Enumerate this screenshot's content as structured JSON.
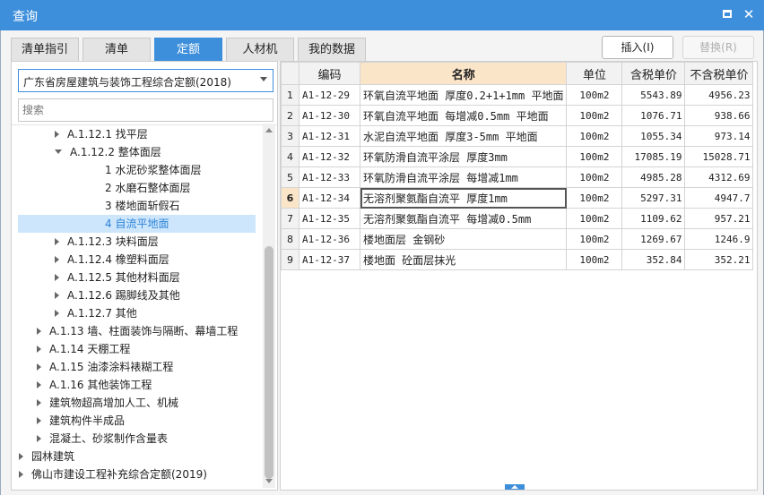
{
  "window": {
    "title": "查询"
  },
  "tabs": [
    {
      "label": "清单指引",
      "active": false
    },
    {
      "label": "清单",
      "active": false
    },
    {
      "label": "定额",
      "active": true
    },
    {
      "label": "人材机",
      "active": false
    },
    {
      "label": "我的数据",
      "active": false
    }
  ],
  "toolbar": {
    "insert_label": "插入(I)",
    "replace_label": "替换(R)"
  },
  "library": {
    "selected": "广东省房屋建筑与装饰工程综合定额(2018)"
  },
  "search": {
    "placeholder": "搜索"
  },
  "tree": [
    {
      "label": "A.1.12.1 找平层",
      "expander": "collapsed",
      "selected": false
    },
    {
      "label": "A.1.12.2 整体面层",
      "expander": "expanded",
      "selected": false
    },
    {
      "label": "1 水泥砂浆整体面层",
      "expander": "none",
      "selected": false
    },
    {
      "label": "2 水磨石整体面层",
      "expander": "none",
      "selected": false
    },
    {
      "label": "3 楼地面斩假石",
      "expander": "none",
      "selected": false
    },
    {
      "label": "4 自流平地面",
      "expander": "none",
      "selected": true
    },
    {
      "label": "A.1.12.3 块料面层",
      "expander": "collapsed",
      "selected": false
    },
    {
      "label": "A.1.12.4 橡塑料面层",
      "expander": "collapsed",
      "selected": false
    },
    {
      "label": "A.1.12.5 其他材料面层",
      "expander": "collapsed",
      "selected": false
    },
    {
      "label": "A.1.12.6 踢脚线及其他",
      "expander": "collapsed",
      "selected": false
    },
    {
      "label": "A.1.12.7 其他",
      "expander": "collapsed",
      "selected": false
    },
    {
      "label": "A.1.13 墙、柱面装饰与隔断、幕墙工程",
      "expander": "collapsed",
      "selected": false
    },
    {
      "label": "A.1.14 天棚工程",
      "expander": "collapsed",
      "selected": false
    },
    {
      "label": "A.1.15 油漆涂料裱糊工程",
      "expander": "collapsed",
      "selected": false
    },
    {
      "label": "A.1.16 其他装饰工程",
      "expander": "collapsed",
      "selected": false
    },
    {
      "label": "建筑物超高增加人工、机械",
      "expander": "collapsed",
      "selected": false
    },
    {
      "label": "建筑构件半成品",
      "expander": "collapsed",
      "selected": false
    },
    {
      "label": "混凝土、砂浆制作含量表",
      "expander": "collapsed",
      "selected": false
    },
    {
      "label": "园林建筑",
      "expander": "collapsed",
      "selected": false
    },
    {
      "label": "佛山市建设工程补充综合定额(2019)",
      "expander": "collapsed",
      "selected": false
    }
  ],
  "table": {
    "columns": [
      "编码",
      "名称",
      "单位",
      "含税单价",
      "不含税单价"
    ],
    "rows": [
      {
        "n": "1",
        "code": "A1-12-29",
        "name": "环氧自流平地面 厚度0.2+1+1mm 平地面",
        "unit": "100m2",
        "price_tax": "5543.89",
        "price_notax": "4956.23"
      },
      {
        "n": "2",
        "code": "A1-12-30",
        "name": "环氧自流平地面 每增减0.5mm 平地面",
        "unit": "100m2",
        "price_tax": "1076.71",
        "price_notax": "938.66"
      },
      {
        "n": "3",
        "code": "A1-12-31",
        "name": "水泥自流平地面 厚度3-5mm 平地面",
        "unit": "100m2",
        "price_tax": "1055.34",
        "price_notax": "973.14"
      },
      {
        "n": "4",
        "code": "A1-12-32",
        "name": "环氧防滑自流平涂层 厚度3mm",
        "unit": "100m2",
        "price_tax": "17085.19",
        "price_notax": "15028.71"
      },
      {
        "n": "5",
        "code": "A1-12-33",
        "name": "环氧防滑自流平涂层 每增减1mm",
        "unit": "100m2",
        "price_tax": "4985.28",
        "price_notax": "4312.69"
      },
      {
        "n": "6",
        "code": "A1-12-34",
        "name": "无溶剂聚氨酯自流平 厚度1mm",
        "unit": "100m2",
        "price_tax": "5297.31",
        "price_notax": "4947.7"
      },
      {
        "n": "7",
        "code": "A1-12-35",
        "name": "无溶剂聚氨酯自流平 每增减0.5mm",
        "unit": "100m2",
        "price_tax": "1109.62",
        "price_notax": "957.21"
      },
      {
        "n": "8",
        "code": "A1-12-36",
        "name": "楼地面层 金钢砂",
        "unit": "100m2",
        "price_tax": "1269.67",
        "price_notax": "1246.9"
      },
      {
        "n": "9",
        "code": "A1-12-37",
        "name": "楼地面 砼面层抹光",
        "unit": "100m2",
        "price_tax": "352.84",
        "price_notax": "352.21"
      }
    ],
    "current_row": 5
  },
  "colors": {
    "accent": "#3d8fdc",
    "header_highlight": "#fbe5c8",
    "selection": "#cde6fb"
  }
}
